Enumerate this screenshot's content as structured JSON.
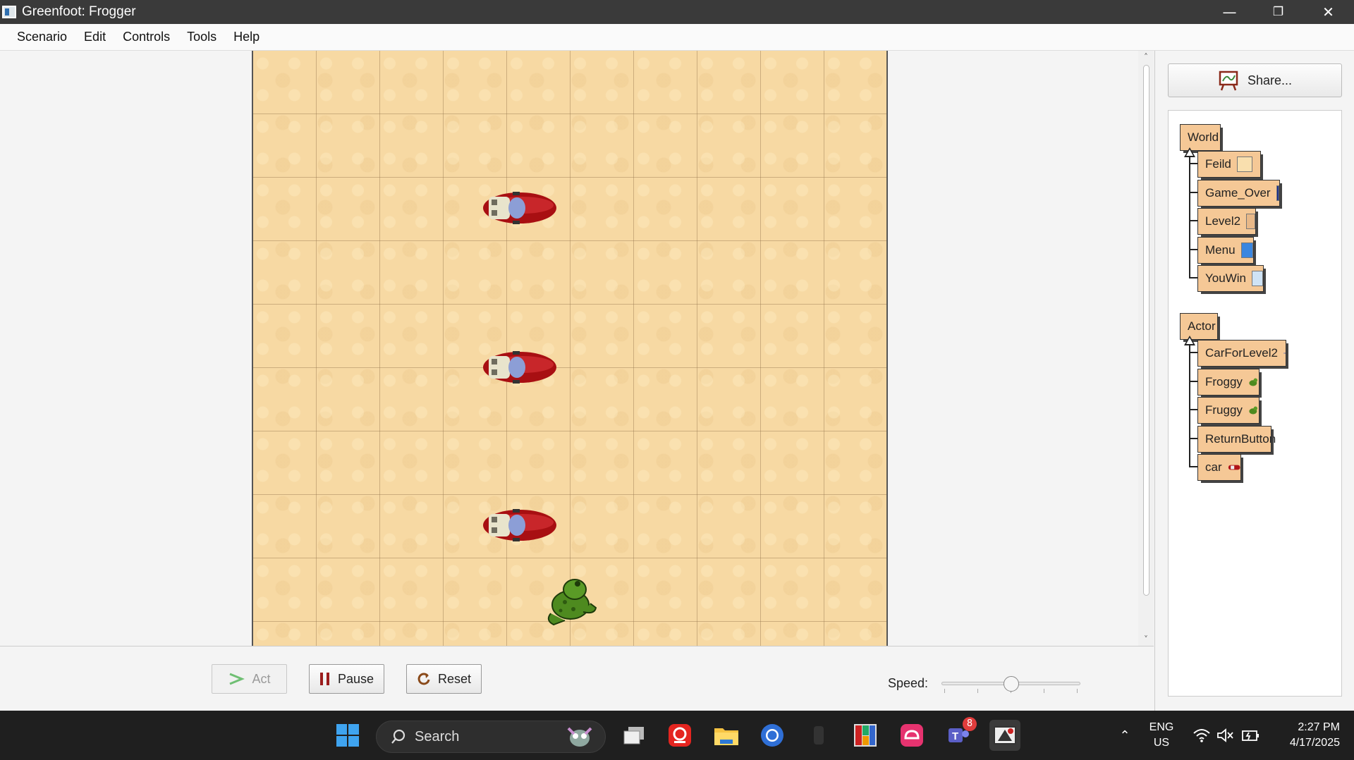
{
  "window": {
    "title": "Greenfoot: Frogger",
    "minimize_icon": "minimize-icon",
    "restore_icon": "restore-icon",
    "close_icon": "close-icon"
  },
  "menu": {
    "items": [
      "Scenario",
      "Edit",
      "Controls",
      "Tools",
      "Help"
    ]
  },
  "world": {
    "background_color": "#f7d9a3",
    "actors": [
      "car",
      "car",
      "car",
      "frog"
    ]
  },
  "controls": {
    "act_label": "Act",
    "pause_label": "Pause",
    "reset_label": "Reset",
    "speed_label": "Speed:",
    "speed_value": 0.5
  },
  "share": {
    "label": "Share..."
  },
  "classes": {
    "world_root": "World",
    "world_subclasses": [
      {
        "name": "Feild",
        "swatch": "#f9dfae"
      },
      {
        "name": "Game_Over",
        "swatch": "#1a2f8a"
      },
      {
        "name": "Level2",
        "swatch": "#e8b888"
      },
      {
        "name": "Menu",
        "swatch": "#3a86e0"
      },
      {
        "name": "YouWin",
        "swatch": "#cfe3f5"
      }
    ],
    "actor_root": "Actor",
    "actor_subclasses": [
      {
        "name": "CarForLevel2",
        "icon": "blue-car-icon"
      },
      {
        "name": "Froggy",
        "icon": "frog-icon"
      },
      {
        "name": "Fruggy",
        "icon": "frog-icon"
      },
      {
        "name": "ReturnButton",
        "icon": ""
      },
      {
        "name": "car",
        "icon": "red-car-icon"
      }
    ]
  },
  "taskbar": {
    "search_label": "Search",
    "lang_line1": "ENG",
    "lang_line2": "US",
    "time": "2:27 PM",
    "date": "4/17/2025",
    "teams_badge": "8"
  }
}
